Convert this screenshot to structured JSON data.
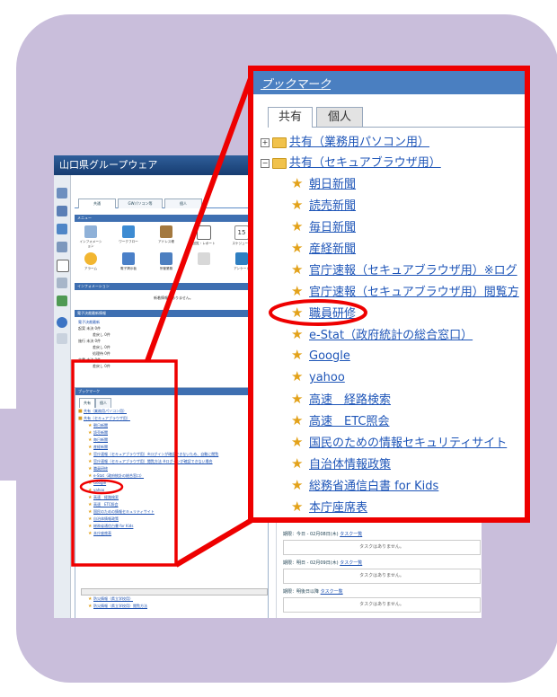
{
  "small": {
    "app_title": "山口県グループウェア",
    "tabs": [
      "共通",
      "GWパソコン等",
      "個人"
    ],
    "menu_header": "メニュー",
    "menu_items": [
      "インフォメーション",
      "ワークフロー",
      "アドレス帳",
      "回覧・レポート",
      "スケジュール",
      "アラーム",
      "電子掲示板",
      "所管業務",
      "",
      "アンケート"
    ],
    "calendar_day": "15",
    "info_header": "インフォメーション",
    "info_empty": "新着情報はありません。",
    "epost_header": "電子決裁最新情報",
    "epost_lines": [
      "電子決裁最新",
      "起案 未決 0件",
      "差戻し 0件",
      "施行 未決 0件",
      "差戻し 0件",
      "処理待 0件",
      "文書 未決 0件",
      "差戻し 0件"
    ],
    "bookmark_header": "ブックマーク",
    "bookmark_tabs": [
      "共有",
      "個人"
    ],
    "bookmark_folders": [
      "共有（業務用パソコン用）",
      "共有（セキュアブラウザ用）"
    ],
    "bookmark_items": [
      "朝日新聞",
      "読売新聞",
      "毎日新聞",
      "産経新聞",
      "官庁速報（セキュアブラウザ用）※ログインが確認できないため、自動に閲覧",
      "官庁速報（セキュアブラウザ用）閲覧方法 ※ログインが確認できない場合",
      "職員研修",
      "e-Stat（政府統計の総合窓口）",
      "Google",
      "yahoo",
      "高速　経路検索",
      "高速　ETC照会",
      "国民のための情報セキュリティサイト",
      "自治体情報政策",
      "総務省通信白書 for Kids",
      "本庁座席表"
    ],
    "bookmark_items_lower": [
      "防災情報（県立学校用）",
      "防災情報（県立学校用）閲覧方法"
    ],
    "tasks": [
      {
        "label": "期限：今日 - 02月08日(木)",
        "link": "タスク一覧",
        "empty": "タスクはありません。"
      },
      {
        "label": "期限：明日 - 02月09日(木)",
        "link": "タスク一覧",
        "empty": "タスクはありません。"
      },
      {
        "label": "期限：明後日以降",
        "link": "タスク一覧",
        "empty": "タスクはありません。"
      }
    ]
  },
  "zoom": {
    "header": "ブックマーク",
    "tabs": [
      "共有",
      "個人"
    ],
    "folders": [
      "共有（業務用パソコン用）",
      "共有（セキュアブラウザ用）"
    ],
    "items": [
      "朝日新聞",
      "読売新聞",
      "毎日新聞",
      "産経新聞",
      "官庁速報（セキュアブラウザ用）※ログ",
      "官庁速報（セキュアブラウザ用）閲覧方",
      "職員研修",
      "e-Stat（政府統計の総合窓口）",
      "Google",
      "yahoo",
      "高速　経路検索",
      "高速　ETC照会",
      "国民のための情報セキュリティサイト",
      "自治体情報政策",
      "総務省通信白書 for Kids",
      "本庁座席表"
    ],
    "highlighted_item": "職員研修"
  },
  "colors": {
    "highlight": "#ee0000",
    "panel": "#c9bedb",
    "header_blue": "#4a7fc1",
    "link": "#1f56b8",
    "star": "#e3a21a"
  },
  "icons": [
    "folder-icon",
    "expand-toggle-icon",
    "star-icon"
  ]
}
